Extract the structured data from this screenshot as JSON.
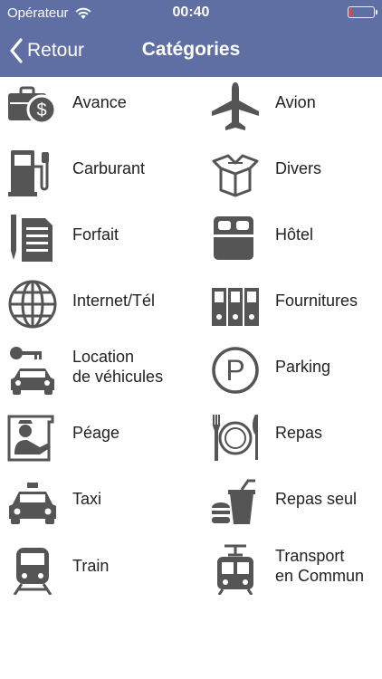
{
  "status": {
    "carrier": "Opérateur",
    "time": "00:40",
    "battery_level": 0.1
  },
  "nav": {
    "back_label": "Retour",
    "title": "Catégories"
  },
  "categories": [
    {
      "label": "Avance",
      "label2": "",
      "icon": "money-briefcase-icon"
    },
    {
      "label": "Avion",
      "label2": "",
      "icon": "airplane-icon"
    },
    {
      "label": "Carburant",
      "label2": "",
      "icon": "fuel-pump-icon"
    },
    {
      "label": "Divers",
      "label2": "",
      "icon": "open-box-icon"
    },
    {
      "label": "Forfait",
      "label2": "",
      "icon": "document-pencil-icon"
    },
    {
      "label": "Hôtel",
      "label2": "",
      "icon": "bed-icon"
    },
    {
      "label": "Internet/Tél",
      "label2": "",
      "icon": "globe-icon"
    },
    {
      "label": "Fournitures",
      "label2": "",
      "icon": "binders-icon"
    },
    {
      "label": "Location",
      "label2": "de véhicules",
      "icon": "car-key-icon"
    },
    {
      "label": "Parking",
      "label2": "",
      "icon": "parking-icon"
    },
    {
      "label": "Péage",
      "label2": "",
      "icon": "toll-booth-icon"
    },
    {
      "label": "Repas",
      "label2": "",
      "icon": "plate-cutlery-icon"
    },
    {
      "label": "Taxi",
      "label2": "",
      "icon": "taxi-icon"
    },
    {
      "label": "Repas seul",
      "label2": "",
      "icon": "fast-food-icon"
    },
    {
      "label": "Train",
      "label2": "",
      "icon": "train-icon"
    },
    {
      "label": "Transport",
      "label2": "en Commun",
      "icon": "tram-icon"
    }
  ]
}
